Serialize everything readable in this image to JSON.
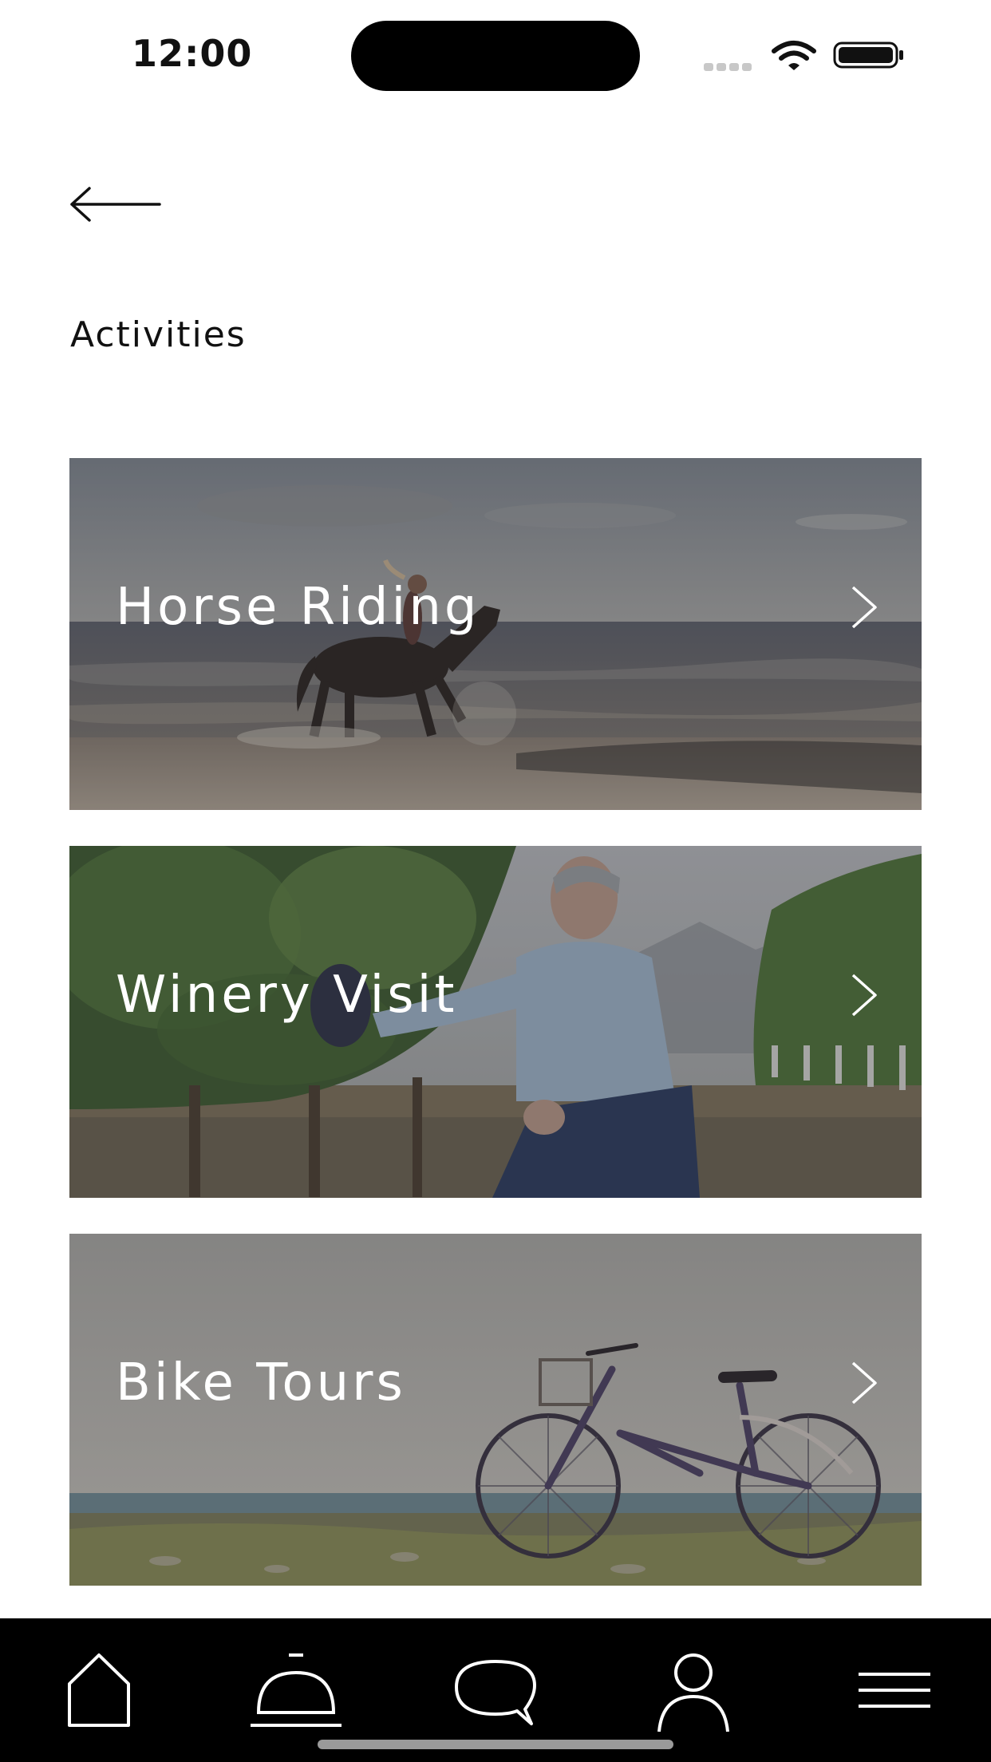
{
  "status_bar": {
    "time": "12:00"
  },
  "header": {
    "title": "Activities"
  },
  "activities": [
    {
      "label": "Horse Riding"
    },
    {
      "label": "Winery Visit"
    },
    {
      "label": "Bike Tours"
    }
  ],
  "tab_bar": {
    "tabs": [
      {
        "icon": "home-icon"
      },
      {
        "icon": "concierge-bell-icon",
        "selected": true
      },
      {
        "icon": "chat-bubble-icon"
      },
      {
        "icon": "user-profile-icon"
      },
      {
        "icon": "menu-icon"
      }
    ]
  },
  "colors": {
    "tab_bar_bg": "#000000",
    "text": "#111111",
    "card_text": "#ffffff"
  }
}
